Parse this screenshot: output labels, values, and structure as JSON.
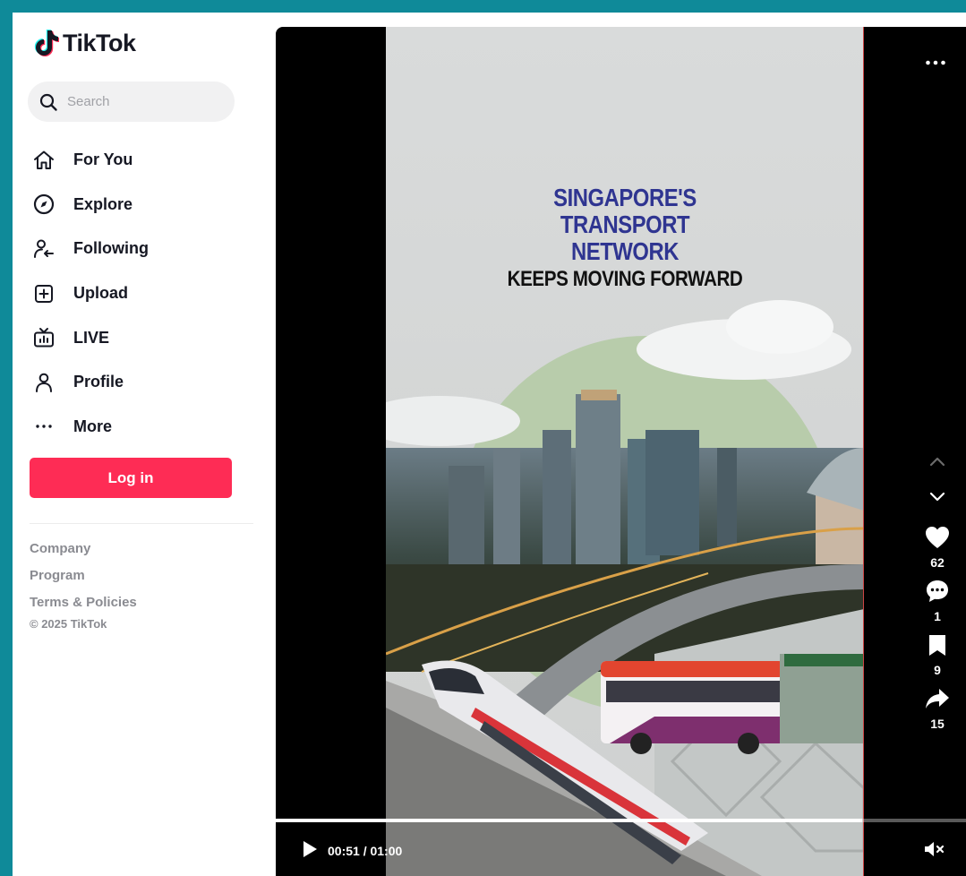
{
  "brand": {
    "name": "TikTok"
  },
  "search": {
    "placeholder": "Search",
    "icon": "search-icon"
  },
  "nav": {
    "items": [
      {
        "label": "For You",
        "icon": "home-icon"
      },
      {
        "label": "Explore",
        "icon": "compass-icon"
      },
      {
        "label": "Following",
        "icon": "following-icon"
      },
      {
        "label": "Upload",
        "icon": "upload-icon"
      },
      {
        "label": "LIVE",
        "icon": "live-icon"
      },
      {
        "label": "Profile",
        "icon": "profile-icon"
      },
      {
        "label": "More",
        "icon": "more-icon"
      }
    ]
  },
  "login": {
    "label": "Log in"
  },
  "footer": {
    "links": [
      "Company",
      "Program",
      "Terms & Policies"
    ],
    "copyright": "© 2025 TikTok"
  },
  "video": {
    "headline_blue": [
      "SINGAPORE'S",
      "TRANSPORT",
      "NETWORK"
    ],
    "headline_black": "KEEPS MOVING FORWARD"
  },
  "actions": {
    "likes": "62",
    "comments": "1",
    "saves": "9",
    "shares": "15"
  },
  "playback": {
    "time": "00:51 / 01:00",
    "progress": 0.85
  },
  "colors": {
    "accent": "#fe2c55",
    "frame": "#0f8a99",
    "headline_blue": "#2f3591"
  }
}
